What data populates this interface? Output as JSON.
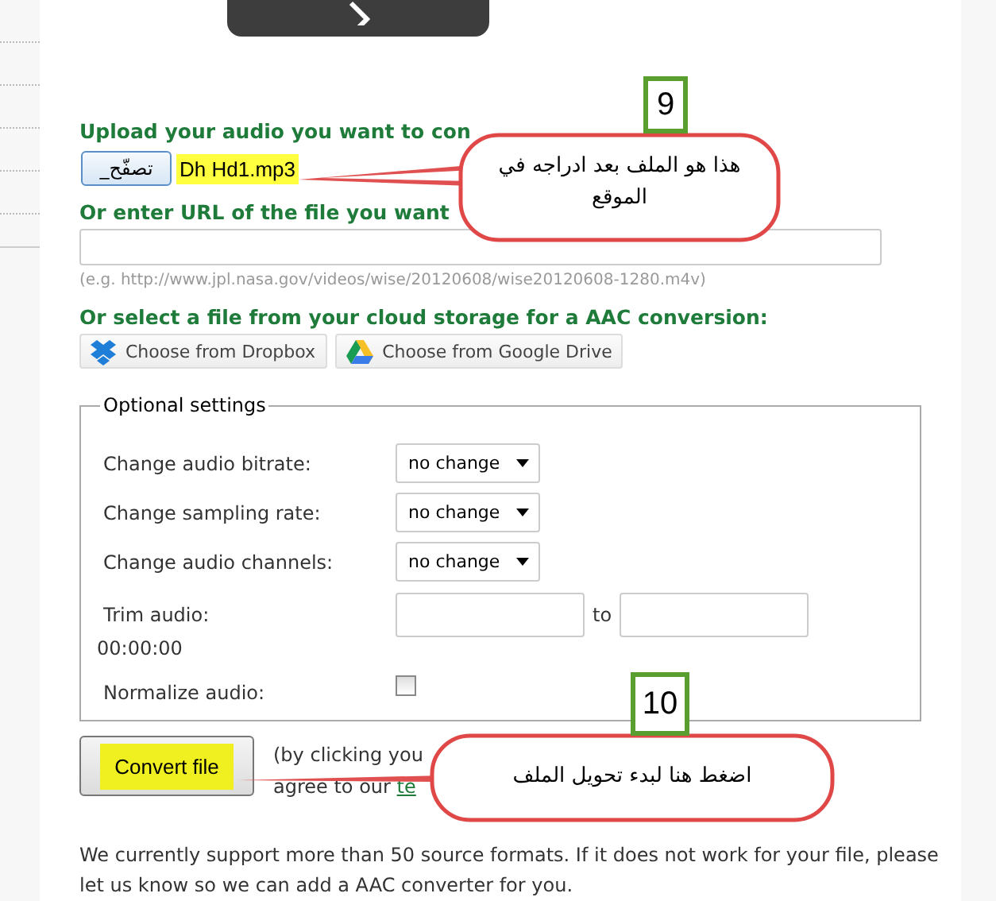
{
  "upload": {
    "heading": "Upload your audio you want to con",
    "browse_button": "_تصفّح",
    "file_name": "Dh Hd1.mp3"
  },
  "url": {
    "heading": "Or enter URL of the file you want",
    "example": "(e.g. http://www.jpl.nasa.gov/videos/wise/20120608/wise20120608-1280.m4v)"
  },
  "cloud": {
    "heading": "Or select a file from your cloud storage for a AAC conversion:",
    "buttons": [
      {
        "kind": "dropbox",
        "label": "Choose from Dropbox"
      },
      {
        "kind": "drive",
        "label": "Choose from Google Drive"
      }
    ]
  },
  "optional_settings": {
    "legend": "Optional settings",
    "rows": [
      {
        "kind": "select",
        "label": "Change audio bitrate:",
        "value": "no change"
      },
      {
        "kind": "select",
        "label": "Change sampling rate:",
        "value": "no change"
      },
      {
        "kind": "select",
        "label": "Change audio channels:",
        "value": "no change"
      },
      {
        "kind": "trim",
        "label": "Trim audio:",
        "separator": "to",
        "hint": "00:00:00"
      },
      {
        "kind": "checkbox",
        "label": "Normalize audio:",
        "checked": false
      }
    ]
  },
  "convert": {
    "button": "Convert file",
    "note_line_1": "(by clicking you",
    "note_line_2": "agree to our",
    "link": "te"
  },
  "info": "We currently support more than 50 source formats. If it does not work for your file, please let us know so we can add a AAC converter for you.",
  "callouts": [
    {
      "number": "9",
      "text": "هذا هو الملف بعد ادراجه في الموقع"
    },
    {
      "number": "10",
      "text": "اضغط هنا لبدء تحويل الملف"
    }
  ]
}
